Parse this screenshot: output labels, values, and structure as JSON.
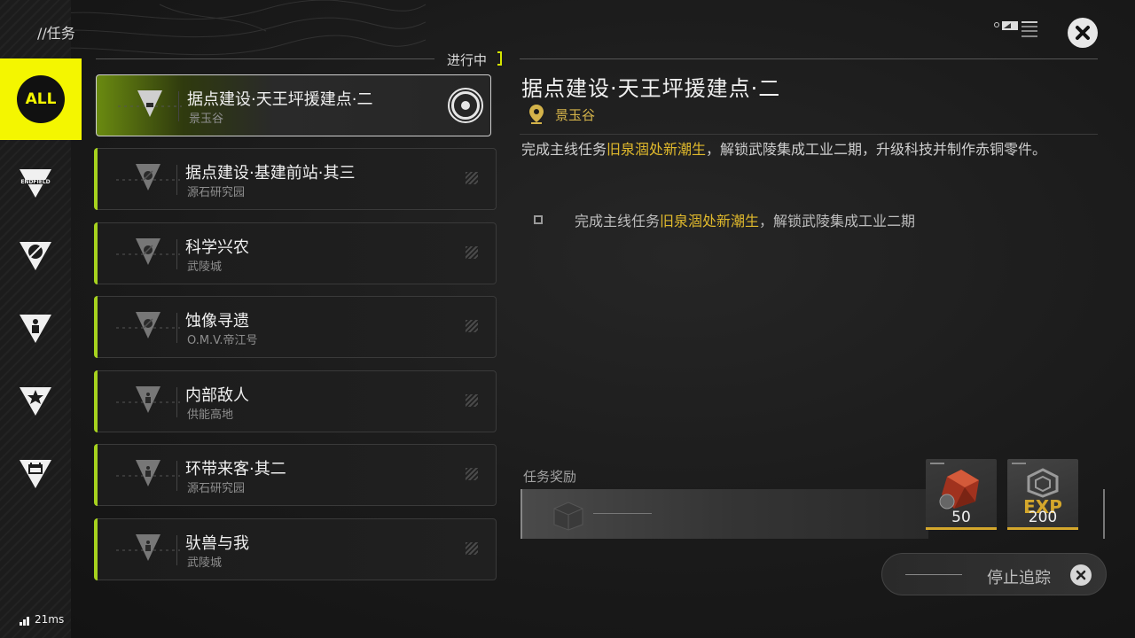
{
  "header": {
    "breadcrumb": "//任务",
    "section_label": "进行中"
  },
  "sidebar": {
    "all_label": "ALL",
    "items": [
      {
        "icon": "endfield-icon"
      },
      {
        "icon": "feather-icon"
      },
      {
        "icon": "person-icon"
      },
      {
        "icon": "star-icon"
      },
      {
        "icon": "calendar-icon"
      }
    ]
  },
  "quests": [
    {
      "title": "据点建设·天王坪援建点·二",
      "location": "景玉谷",
      "active": true
    },
    {
      "title": "据点建设·基建前站·其三",
      "location": "源石研究园",
      "active": false
    },
    {
      "title": "科学兴农",
      "location": "武陵城",
      "active": false
    },
    {
      "title": "蚀像寻遗",
      "location": "O.M.V.帝江号",
      "active": false
    },
    {
      "title": "内部敌人",
      "location": "供能高地",
      "active": false
    },
    {
      "title": "环带来客·其二",
      "location": "源石研究园",
      "active": false
    },
    {
      "title": "驮兽与我",
      "location": "武陵城",
      "active": false
    }
  ],
  "detail": {
    "title": "据点建设·天王坪援建点·二",
    "location": "景玉谷",
    "desc_prefix": "完成主线任务",
    "desc_highlight": "旧泉涸处新潮生",
    "desc_suffix": "，解锁武陵集成工业二期，升级科技并制作赤铜零件。",
    "objective_prefix": "完成主线任务",
    "objective_highlight": "旧泉涸处新潮生",
    "objective_suffix": "，解锁武陵集成工业二期"
  },
  "rewards": {
    "label": "任务奖励",
    "items": [
      {
        "name": "crystal-reward",
        "count": "50"
      },
      {
        "name": "exp-reward",
        "label": "EXP",
        "count": "200"
      }
    ]
  },
  "stop_tracking": {
    "label": "停止追踪"
  },
  "status": {
    "ping": "21ms"
  },
  "colors": {
    "accent_yellow": "#f4f600",
    "accent_green": "#a6d21e",
    "highlight_gold": "#e0b92c"
  }
}
